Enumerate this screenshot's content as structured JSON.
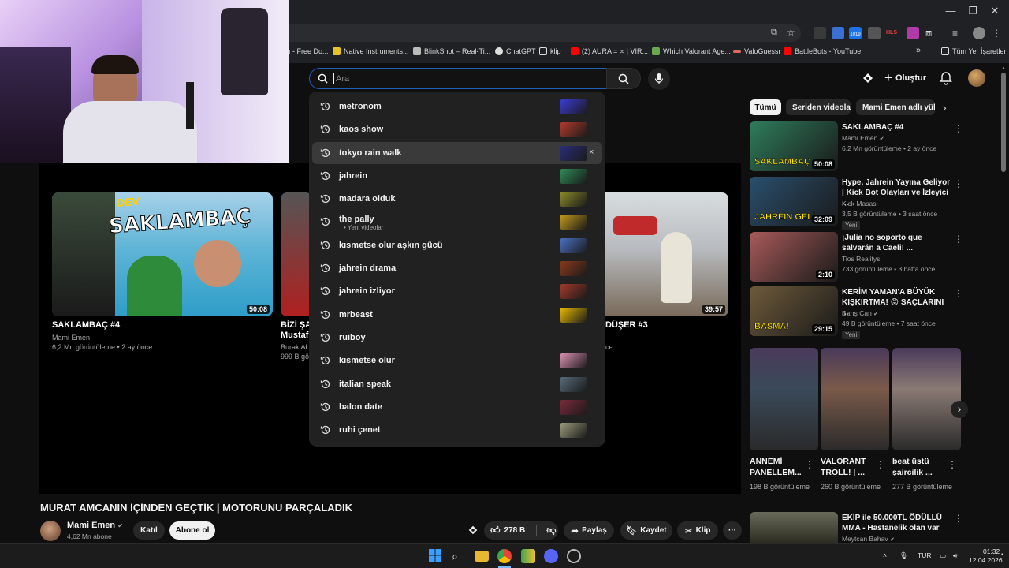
{
  "browser": {
    "bookmarks": [
      {
        "label": "ı - Free Do...",
        "icon_color": "#888888"
      },
      {
        "label": "Native Instruments...",
        "icon_color": "#e6c229"
      },
      {
        "label": "BlinkShot – Real-Ti...",
        "icon_color": "#bbbbbb"
      },
      {
        "label": "ChatGPT",
        "icon_color": "#dddddd"
      },
      {
        "label": "klip",
        "icon_color": "#dddddd"
      },
      {
        "label": "(2) AURA = ∞ | VIR...",
        "icon_color": "#ff0000"
      },
      {
        "label": "Which Valorant Age...",
        "icon_color": "#6aa84f"
      },
      {
        "label": "ValoGuessr",
        "icon_color": "#e06666"
      },
      {
        "label": "BattleBots - YouTube",
        "icon_color": "#ff0000"
      }
    ],
    "more_bookmarks": "»",
    "all_bookmarks": "Tüm Yer İşaretleri",
    "ext_badge": "1019",
    "ext_label": "HLS"
  },
  "search": {
    "placeholder": "Ara",
    "suggestions": [
      {
        "text": "metronom",
        "sub": "",
        "thumb": "#3b3bd6"
      },
      {
        "text": "kaos show",
        "sub": "",
        "thumb": "#b33a2a"
      },
      {
        "text": "tokyo rain walk",
        "sub": "",
        "thumb": "#2a2d7a",
        "highlighted": true,
        "remove": "×"
      },
      {
        "text": "jahrein",
        "sub": "",
        "thumb": "#2e8b57"
      },
      {
        "text": "madara olduk",
        "sub": "",
        "thumb": "#8a8a2a"
      },
      {
        "text": "the pally",
        "sub": "• Yeni videolar",
        "thumb": "#c29b1a"
      },
      {
        "text": "kısmetse olur aşkın gücü",
        "sub": "",
        "thumb": "#4a70c2"
      },
      {
        "text": "jahrein drama",
        "sub": "",
        "thumb": "#8a3a1a"
      },
      {
        "text": "jahrein izliyor",
        "sub": "",
        "thumb": "#a03a2a"
      },
      {
        "text": "mrbeast",
        "sub": "",
        "thumb": "#e6b800"
      },
      {
        "text": "ruiboy",
        "sub": "",
        "thumb": ""
      },
      {
        "text": "kısmetse olur",
        "sub": "",
        "thumb": "#d98fb0"
      },
      {
        "text": "italian speak",
        "sub": "",
        "thumb": "#566a7a"
      },
      {
        "text": "balon date",
        "sub": "",
        "thumb": "#7a2a3a"
      },
      {
        "text": "ruhi çenet",
        "sub": "",
        "thumb": "#9a9a7a"
      }
    ]
  },
  "header": {
    "create_label": "Oluştur"
  },
  "player_cards": [
    {
      "title": "SAKLAMBAÇ #4",
      "channel": "Mami Emen",
      "meta": "6,2 Mn görüntüleme • 2 ay önce",
      "duration": "50:08",
      "thumb_text_top": "DEV",
      "thumb_text": "SAKLAMBAÇ"
    },
    {
      "title": "BİZİ ŞA",
      "title2": "Mustaf",
      "channel": "Burak Al",
      "meta": "999 B gö",
      "duration": ""
    },
    {
      "title": "DÜŞER #3",
      "channel": "",
      "meta": "ce",
      "duration": "39:57"
    }
  ],
  "video": {
    "title": "MURAT AMCANIN İÇİNDEN GEÇTİK | MOTORUNU PARÇALADIK",
    "channel": "Mami Emen",
    "subs": "4,62 Mn abone",
    "join_label": "Katıl",
    "subscribe_label": "Abone ol",
    "likes": "278 B",
    "share_label": "Paylaş",
    "save_label": "Kaydet",
    "clip_label": "Klip"
  },
  "sidebar": {
    "chips": [
      "Tümü",
      "Seriden videolar",
      "Mami Emen adlı yükle"
    ],
    "videos": [
      {
        "title": "SAKLAMBAÇ #4",
        "channel": "Mami Emen",
        "verified": true,
        "meta": "6,2 Mn görüntüleme • 2 ay önce",
        "duration": "50:08",
        "badge": "",
        "thumb": "#2e7d5b",
        "thumb_text": "SAKLAMBAÇ"
      },
      {
        "title": "Hype, Jahrein Yayına Geliyor | Kick Bot Olayları ve İzleyici ...",
        "channel": "Kick Masası",
        "verified": false,
        "meta": "3,5 B görüntüleme • 3 saat önce",
        "duration": "32:09",
        "badge": "Yeni",
        "thumb": "#2a4f6e",
        "thumb_text": "JAHREIN GELİ"
      },
      {
        "title": "¡Julia no soporto que salvarán a Caeli! ...",
        "channel": "Tios Realitys",
        "verified": false,
        "meta": "733 görüntüleme • 3 hafta önce",
        "duration": "2:10",
        "badge": "",
        "thumb": "#a85a5a",
        "thumb_text": ""
      },
      {
        "title": "KERİM YAMAN'A BÜYÜK KIŞKIRTMA! 😡 SAÇLARINI ...",
        "channel": "Barış Can",
        "verified": true,
        "meta": "49 B görüntüleme • 7 saat önce",
        "duration": "29:15",
        "badge": "Yeni",
        "thumb": "#6e5a3a",
        "thumb_text": "BASMA!"
      }
    ],
    "shorts": [
      {
        "title": "ANNEMİ PANELLEM...",
        "meta": "198 B görüntüleme",
        "thumb": "#3a4a5a"
      },
      {
        "title": "VALORANT TROLL! | ...",
        "meta": "260 B görüntüleme",
        "thumb": "#7a5a4a"
      },
      {
        "title": "beat üstü şaircilik ...",
        "meta": "277 B görüntüleme",
        "thumb": "#8a7a74"
      }
    ],
    "bottom_video": {
      "title": "EKİP ile 50.000TL ÖDÜLLÜ MMA - Hastanelik olan var",
      "channel": "Meytcan Bahav",
      "verified": true,
      "thumb": "#4a4a3a"
    }
  },
  "taskbar": {
    "lang": "TUR",
    "time": "01:32",
    "date": "12.04.2026"
  }
}
